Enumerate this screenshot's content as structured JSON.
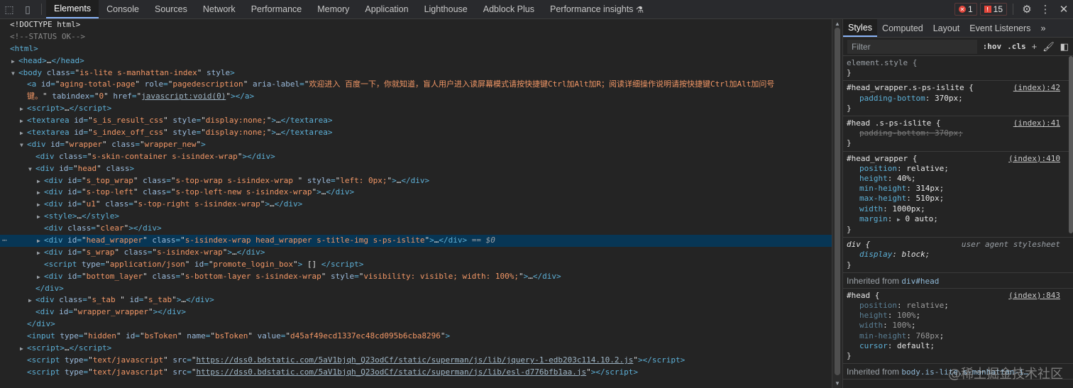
{
  "topbar": {
    "tabs": [
      "Elements",
      "Console",
      "Sources",
      "Network",
      "Performance",
      "Memory",
      "Application",
      "Lighthouse",
      "Adblock Plus",
      "Performance insights"
    ],
    "errors_count": "1",
    "issues_count": "15"
  },
  "tree": {
    "doctype": "<!DOCTYPE html>",
    "comment": "<!--STATUS OK-->",
    "r_html": "html",
    "r_head": "head",
    "r_body_tag": "body",
    "r_body_class": "is-lite  s-manhattan-index",
    "r_body_style": "style",
    "r_a_id": "aging-total-page",
    "r_a_role": "pagedescription",
    "r_a_label_1": "欢迎进入 百度一下，你就知道，盲人用户进入读屏幕模式请按快捷键Ctrl加Alt加R；阅读详细操作说明请按快捷键Ctrl加Alt加问号",
    "r_a_label_2": "键。",
    "r_a_tabindex": "0",
    "r_a_href": "javascript:void(0)",
    "r_textarea1_id": "s_is_result_css",
    "r_textarea2_id": "s_index_off_css",
    "r_textarea_style": "display:none;",
    "r_wrapper_id": "wrapper",
    "r_wrapper_class": "wrapper_new",
    "r_skin_class": "s-skin-container s-isindex-wrap",
    "r_head_id": "head",
    "r_topwrap_id": "s_top_wrap",
    "r_topwrap_class": "s-top-wrap s-isindex-wrap ",
    "r_topwrap_style": "left: 0px;",
    "r_topleft_id": "s-top-left",
    "r_topleft_class": "s-top-left-new s-isindex-wrap",
    "r_u1_id": "u1",
    "r_u1_class": "s-top-right s-isindex-wrap",
    "r_clear_class": "clear",
    "r_hw_id": "head_wrapper",
    "r_hw_class": "s-isindex-wrap head_wrapper s-title-img s-ps-islite",
    "r_hw_eq": "== $0",
    "r_swrap_id": "s_wrap",
    "r_swrap_class": "s-isindex-wrap",
    "r_script_type": "application/json",
    "r_script_id": "promote_login_box",
    "r_script_text": "[]",
    "r_bl_id": "bottom_layer",
    "r_bl_class": "s-bottom-layer s-isindex-wrap",
    "r_bl_style": "visibility: visible; width: 100%;",
    "r_stab_class": "s_tab ",
    "r_stab_id": "s_tab",
    "r_ww_id": "wrapper_wrapper",
    "r_input_type": "hidden",
    "r_input_id": "bsToken",
    "r_input_name": "bsToken",
    "r_input_value": "d45af49ecd1337ec48cd095b6cba8296",
    "r_js_type": "text/javascript",
    "r_js1_src": "https://dss0.bdstatic.com/5aV1bjqh_Q23odCf/static/superman/js/lib/jquery-1-edb203c114.10.2.js",
    "r_js2_src": "https://dss0.bdstatic.com/5aV1bjqh_Q23odCf/static/superman/js/lib/esl-d776bfb1aa.js"
  },
  "styles": {
    "tabs": [
      "Styles",
      "Computed",
      "Layout",
      "Event Listeners"
    ],
    "filter_placeholder": "Filter",
    "hov": ":hov",
    "cls": ".cls",
    "element_style": "element.style {",
    "rule1_sel": "#head_wrapper.s-ps-islite {",
    "rule1_src": "(index):42",
    "rule1_p1": "padding-bottom",
    "rule1_v1": "370px",
    "rule2_sel": "#head .s-ps-islite {",
    "rule2_src": "(index):41",
    "rule2_p1": "padding-bottom",
    "rule2_v1": "370px",
    "rule3_sel": "#head_wrapper {",
    "rule3_src": "(index):410",
    "rule3_props": [
      {
        "p": "position",
        "v": "relative"
      },
      {
        "p": "height",
        "v": "40%"
      },
      {
        "p": "min-height",
        "v": "314px"
      },
      {
        "p": "max-height",
        "v": "510px"
      },
      {
        "p": "width",
        "v": "1000px"
      },
      {
        "p": "margin",
        "v": "0 auto"
      }
    ],
    "rule4_sel": "div {",
    "rule4_src": "user agent stylesheet",
    "rule4_p1": "display",
    "rule4_v1": "block",
    "inh1_label": "Inherited from",
    "inh1_link": "div#head",
    "rule5_sel": "#head {",
    "rule5_src": "(index):843",
    "rule5_props": [
      {
        "p": "position",
        "v": "relative"
      },
      {
        "p": "height",
        "v": "100%"
      },
      {
        "p": "width",
        "v": "100%"
      },
      {
        "p": "min-height",
        "v": "768px"
      },
      {
        "p": "cursor",
        "v": "default"
      }
    ],
    "inh2_label": "Inherited from",
    "inh2_link": "body.is-lite.s-manhattan-i…",
    "close_brace": "}"
  },
  "watermark": "@稀土掘金技术社区"
}
